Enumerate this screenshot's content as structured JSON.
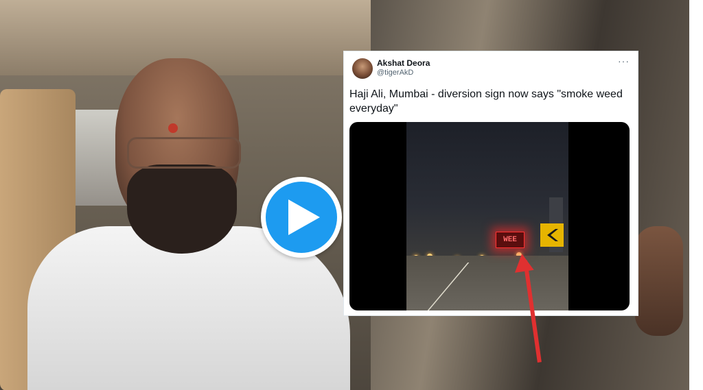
{
  "tweet": {
    "author_name": "Akshat Deora",
    "author_handle": "@tigerAkD",
    "more_label": "···",
    "text": "Haji Ali, Mumbai - diversion sign now says \"smoke weed everyday\"",
    "sign_text": "WEE"
  },
  "icons": {
    "play": "play-icon",
    "chevron": "chevron-left-icon",
    "arrow": "red-arrow-icon"
  },
  "colors": {
    "play_blue": "#1d9bf0",
    "arrow_red": "#e03030",
    "sign_red": "#ff3030",
    "chevron_yellow": "#e6b400"
  }
}
